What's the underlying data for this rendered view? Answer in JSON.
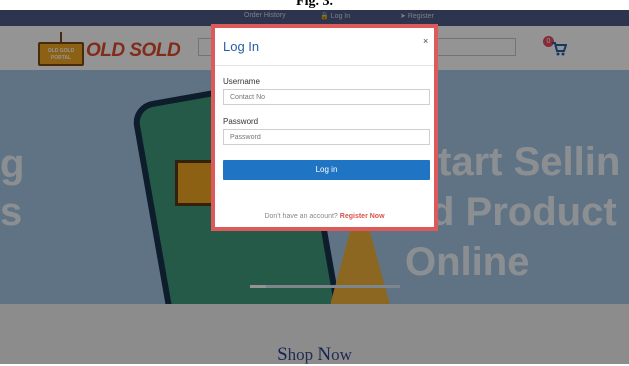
{
  "caption": "Fig. 3.",
  "topbar": {
    "order_history": "Order History",
    "login": "Log In",
    "register": "Register"
  },
  "header": {
    "logo_sign_line1": "OLD GOLD",
    "logo_sign_line2": "PORTAL",
    "logo_text": "OLD SOLD",
    "cart_count": "0"
  },
  "hero": {
    "left_line1": "g",
    "left_line2": "s",
    "right_line1": "tart Sellin",
    "right_line2": "d Product",
    "right_line3": "Online"
  },
  "shop_section": {
    "title_S": "S",
    "title_hop": "hop ",
    "title_N": "N",
    "title_ow": "ow"
  },
  "modal": {
    "title": "Log In",
    "close": "×",
    "username_label": "Username",
    "username_placeholder": "Contact No",
    "password_label": "Password",
    "password_placeholder": "Password",
    "login_button": "Log in",
    "register_prompt": "Don't have an account?",
    "register_link": "Register Now"
  },
  "colors": {
    "accent": "#1f74c4",
    "modal_border": "#dd5a5a",
    "register_link": "#d9534f",
    "topbar": "#4f5a86"
  }
}
